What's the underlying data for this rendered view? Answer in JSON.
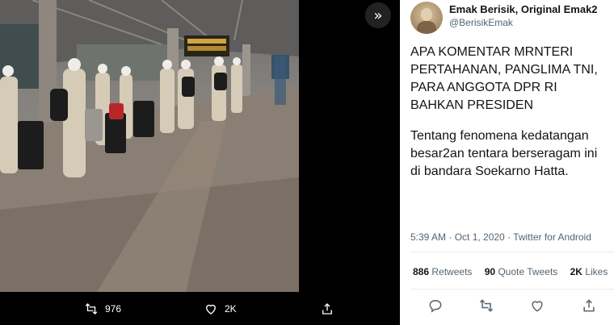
{
  "media": {
    "caption_ghost": "",
    "retweet_count": "976",
    "like_count": "2K"
  },
  "tweet": {
    "display_name": "Emak Berisik, Original Emak2",
    "handle": "@BerisikEmak",
    "paragraph1": "APA KOMENTAR MRNTERI PERTAHANAN, PANGLIMA TNI, PARA ANGGOTA DPR RI BAHKAN PRESIDEN",
    "paragraph2": "Tentang fenomena kedatangan besar2an tentara berseragam ini di bandara Soekarno Hatta.",
    "timestamp": "5:39 AM · Oct 1, 2020 · Twitter for Android",
    "stats": {
      "retweets_count": "886",
      "retweets_label": "Retweets",
      "quotes_count": "90",
      "quotes_label": "Quote Tweets",
      "likes_count": "2K",
      "likes_label": "Likes"
    }
  },
  "icons": {
    "next": "chevron-double-right-icon",
    "reply": "reply-icon",
    "retweet": "retweet-icon",
    "like": "heart-icon",
    "share": "share-icon"
  }
}
